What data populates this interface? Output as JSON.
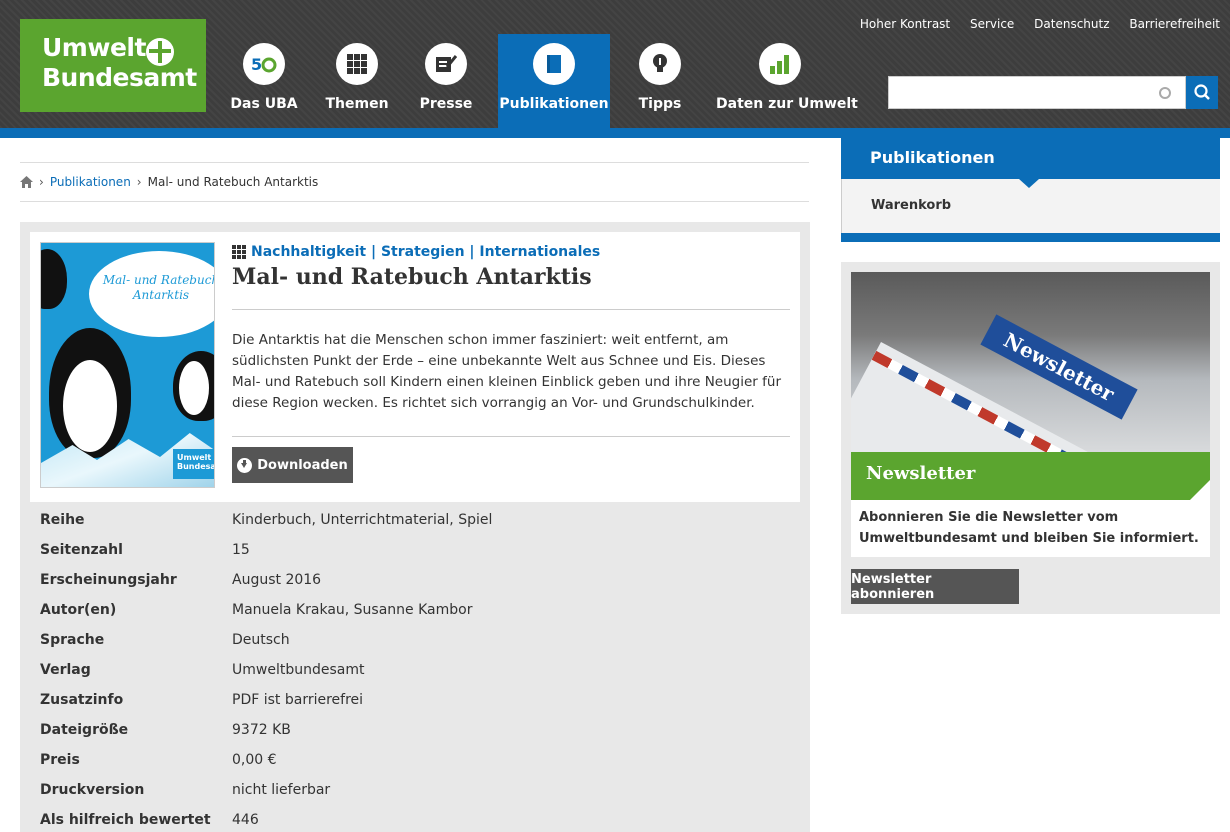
{
  "logo": {
    "line1": "Umwelt",
    "line2": "Bundesamt"
  },
  "nav": [
    {
      "label": "Das UBA",
      "icon": "uba-50-icon"
    },
    {
      "label": "Themen",
      "icon": "grid-icon"
    },
    {
      "label": "Presse",
      "icon": "press-icon"
    },
    {
      "label": "Publikationen",
      "icon": "book-icon",
      "active": true
    },
    {
      "label": "Tipps",
      "icon": "lightbulb-icon"
    },
    {
      "label": "Daten zur Umwelt",
      "icon": "bar-chart-icon"
    }
  ],
  "top_links": [
    "Hoher Kontrast",
    "Service",
    "Datenschutz",
    "Barrierefreiheit"
  ],
  "search": {
    "placeholder": ""
  },
  "breadcrumb": {
    "link": "Publikationen",
    "current": "Mal- und Ratebuch Antarktis"
  },
  "publication": {
    "categories": "Nachhaltigkeit | Strategien | Internationales",
    "title": "Mal- und Ratebuch Antarktis",
    "description": "Die Antarktis hat die Menschen schon immer fasziniert: weit entfernt, am südlichsten Punkt der Erde – eine unbekannte Welt aus Schnee und Eis. Dieses Mal- und Ratebuch soll Kindern einen kleinen Einblick geben und ihre Neugier für diese Region wecken. Es richtet sich vorrangig an Vor- und Grundschulkinder.",
    "download_label": "Downloaden",
    "cover_title": "Mal- und Ratebuch Antarktis",
    "cover_logo_line1": "Umwelt",
    "cover_logo_line2": "Bundesamt"
  },
  "meta": [
    {
      "key": "Reihe",
      "value": "Kinderbuch, Unterrichtmaterial, Spiel"
    },
    {
      "key": "Seitenzahl",
      "value": "15"
    },
    {
      "key": "Erscheinungsjahr",
      "value": "August 2016"
    },
    {
      "key": "Autor(en)",
      "value": "Manuela Krakau, Susanne Kambor"
    },
    {
      "key": "Sprache",
      "value": "Deutsch"
    },
    {
      "key": "Verlag",
      "value": "Umweltbundesamt"
    },
    {
      "key": "Zusatzinfo",
      "value": "PDF ist barrierefrei"
    },
    {
      "key": "Dateigröße",
      "value": "9372 KB"
    },
    {
      "key": "Preis",
      "value": "0,00 €"
    },
    {
      "key": "Druckversion",
      "value": "nicht lieferbar"
    },
    {
      "key": "Als hilfreich bewertet",
      "value": "446"
    }
  ],
  "sidebar": {
    "heading": "Publikationen",
    "item": "Warenkorb"
  },
  "newsletter": {
    "image_label": "Newsletter",
    "title": "Newsletter",
    "text": "Abonnieren Sie die Newsletter vom Umweltbundesamt und bleiben Sie informiert.",
    "button": "Newsletter abonnieren"
  },
  "colors": {
    "brand_green": "#5ba52f",
    "brand_blue": "#0b6db7",
    "header_dark": "#3d3d3d"
  }
}
